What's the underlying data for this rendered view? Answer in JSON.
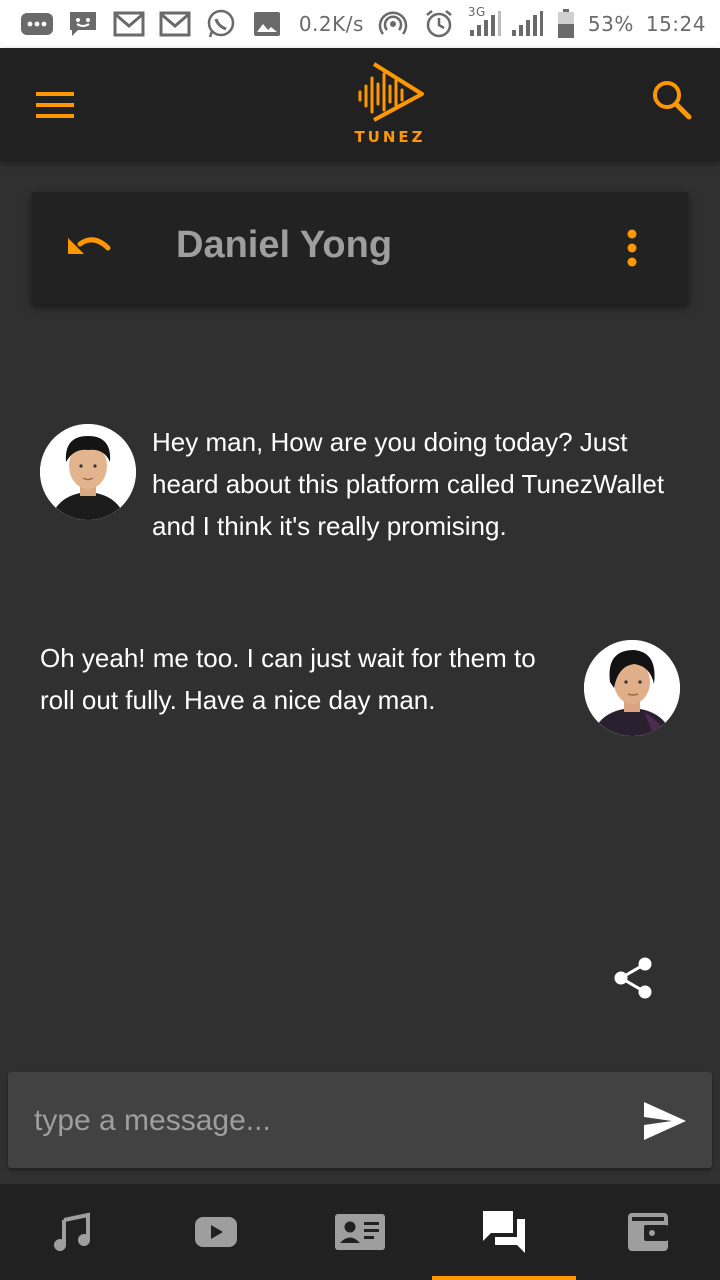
{
  "status_bar": {
    "network_speed": "0.2K/s",
    "network_type": "3G",
    "battery": "53%",
    "time": "15:24",
    "icons": [
      "more-dots-icon",
      "chat-bubble-icon",
      "gmail-icon",
      "gmail-icon",
      "whatsapp-icon",
      "image-icon",
      "hotspot-icon",
      "alarm-icon",
      "signal-icon",
      "signal-icon",
      "battery-icon"
    ]
  },
  "app": {
    "logo_text": "TUNEZ",
    "accent_color": "#ff9800",
    "background_color": "#303030"
  },
  "chat": {
    "contact_name": "Daniel Yong",
    "messages": [
      {
        "side": "incoming",
        "text": "Hey man, How are you doing today? Just heard about this platform called TunezWallet and I think it's really promising."
      },
      {
        "side": "outgoing",
        "text": "Oh yeah! me too. I can just wait for them to roll out fully. Have a nice day man."
      }
    ]
  },
  "compose": {
    "placeholder": "type a message...",
    "value": ""
  },
  "bottom_nav": {
    "items": [
      {
        "icon": "music-note-icon",
        "active": false
      },
      {
        "icon": "youtube-icon",
        "active": false
      },
      {
        "icon": "contact-card-icon",
        "active": false
      },
      {
        "icon": "forum-icon",
        "active": true
      },
      {
        "icon": "wallet-icon",
        "active": false
      }
    ]
  }
}
